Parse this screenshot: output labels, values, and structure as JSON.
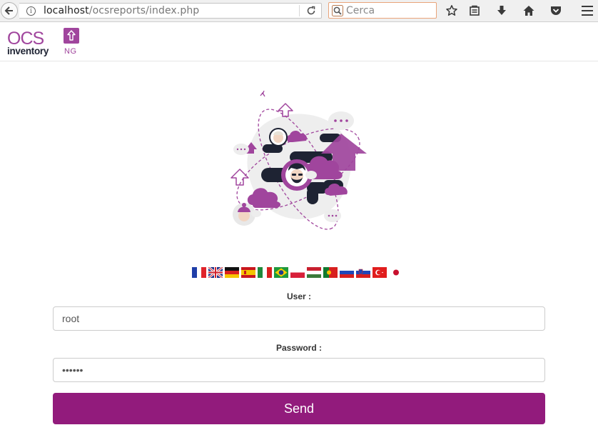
{
  "browser": {
    "url_host": "localhost",
    "url_path": "/ocsreports/index.php",
    "search_placeholder": "Cerca"
  },
  "logo": {
    "word": "OCS",
    "subtitle": "inventory",
    "suffix": "NG"
  },
  "languages": [
    "French",
    "English",
    "German",
    "Spanish",
    "Italian",
    "Brazilian Portuguese",
    "Polish",
    "Hungarian",
    "Portuguese",
    "Russian",
    "Slovenian",
    "Turkish",
    "Japanese"
  ],
  "form": {
    "user_label": "User :",
    "user_value": "root",
    "password_label": "Password :",
    "password_value": "123456",
    "send_label": "Send"
  },
  "colors": {
    "brand_purple": "#921b7c",
    "illustration_purple": "#a0459d",
    "dark_navy": "#1e2333"
  }
}
